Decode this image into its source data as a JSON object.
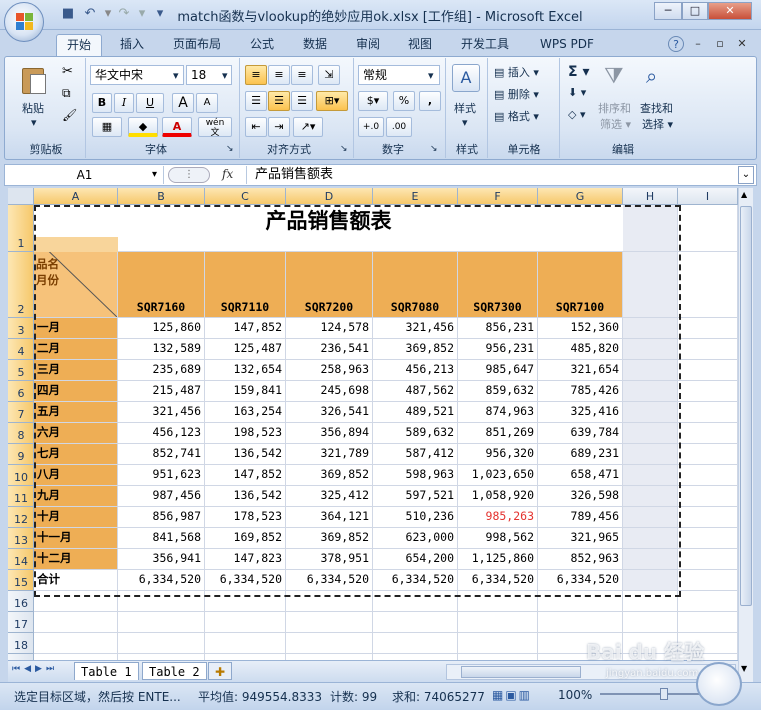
{
  "window": {
    "title": "match函数与vlookup的绝妙应用ok.xlsx  [工作组] - Microsoft Excel",
    "min": "─",
    "max": "□",
    "close": "✕"
  },
  "qat": {
    "save": "💾",
    "undo": "↶",
    "redo": "↷",
    "more": "▾"
  },
  "tabs": [
    "开始",
    "插入",
    "页面布局",
    "公式",
    "数据",
    "审阅",
    "视图",
    "开发工具",
    "WPS PDF"
  ],
  "tabs_active": 0,
  "ribbon": {
    "clipboard": {
      "label": "剪贴板",
      "paste": "粘贴"
    },
    "font": {
      "label": "字体",
      "name": "华文中宋",
      "size": "18",
      "bold": "B",
      "italic": "I",
      "underline": "U",
      "grow": "A",
      "shrink": "A",
      "color": "A",
      "wen": "wén"
    },
    "align": {
      "label": "对齐方式"
    },
    "number": {
      "label": "数字",
      "format": "常规",
      "percent": "%",
      "comma": ",",
      "inc": "+.0",
      "dec": ".00"
    },
    "style": {
      "label": "样式",
      "name": "样式"
    },
    "cells": {
      "label": "单元格",
      "insert": "插入",
      "delete": "删除",
      "format": "格式"
    },
    "edit": {
      "label": "编辑",
      "sort": "排序和",
      "sort2": "筛选",
      "find": "查找和",
      "find2": "选择",
      "sigma": "Σ"
    }
  },
  "formula": {
    "namebox": "A1",
    "fx": "fx",
    "content": "产品销售额表"
  },
  "sheet": {
    "columns": [
      "A",
      "B",
      "C",
      "D",
      "E",
      "F",
      "G",
      "H",
      "I"
    ],
    "title": "产品销售额表",
    "corner_top": "品名",
    "corner_bottom": "月份",
    "products": [
      "SQR7160",
      "SQR7110",
      "SQR7200",
      "SQR7080",
      "SQR7300",
      "SQR7100"
    ],
    "rows": [
      {
        "month": "一月",
        "values": [
          "125,860",
          "147,852",
          "124,578",
          "321,456",
          "856,231",
          "152,360"
        ]
      },
      {
        "month": "二月",
        "values": [
          "132,589",
          "125,487",
          "236,541",
          "369,852",
          "956,231",
          "485,820"
        ]
      },
      {
        "month": "三月",
        "values": [
          "235,689",
          "132,654",
          "258,963",
          "456,213",
          "985,647",
          "321,654"
        ]
      },
      {
        "month": "四月",
        "values": [
          "215,487",
          "159,841",
          "245,698",
          "487,562",
          "859,632",
          "785,426"
        ]
      },
      {
        "month": "五月",
        "values": [
          "321,456",
          "163,254",
          "326,541",
          "489,521",
          "874,963",
          "325,416"
        ]
      },
      {
        "month": "六月",
        "values": [
          "456,123",
          "198,523",
          "356,894",
          "589,632",
          "851,269",
          "639,784"
        ]
      },
      {
        "month": "七月",
        "values": [
          "852,741",
          "136,542",
          "321,789",
          "587,412",
          "956,320",
          "689,231"
        ]
      },
      {
        "month": "八月",
        "values": [
          "951,623",
          "147,852",
          "369,852",
          "598,963",
          "1,023,650",
          "658,471"
        ]
      },
      {
        "month": "九月",
        "values": [
          "987,456",
          "136,542",
          "325,412",
          "597,521",
          "1,058,920",
          "326,598"
        ]
      },
      {
        "month": "十月",
        "values": [
          "856,987",
          "178,523",
          "364,121",
          "510,236",
          "985,263",
          "789,456"
        ]
      },
      {
        "month": "十一月",
        "values": [
          "841,568",
          "169,852",
          "369,852",
          "623,000",
          "998,562",
          "321,965"
        ]
      },
      {
        "month": "十二月",
        "values": [
          "356,941",
          "147,823",
          "378,951",
          "654,200",
          "1,125,860",
          "852,963"
        ]
      }
    ],
    "total_label": "合计",
    "totals": [
      "6,334,520",
      "6,334,520",
      "6,334,520",
      "6,334,520",
      "6,334,520",
      "6,334,520"
    ],
    "highlight_color": "#e4322f",
    "row_numbers": [
      "1",
      "2",
      "3",
      "4",
      "5",
      "6",
      "7",
      "8",
      "9",
      "10",
      "11",
      "12",
      "13",
      "14",
      "15",
      "16",
      "17",
      "18",
      "19"
    ]
  },
  "sheet_tabs": [
    "Table 1",
    "Table 2"
  ],
  "status": {
    "mode": "选定目标区域，然后按 ENTE...",
    "average": "平均值: 949554.8333",
    "count": "计数: 99",
    "sum": "求和: 74065277",
    "zoom": "100%"
  },
  "watermark": "Bai du 经验",
  "watermark_sub": "jingyan.baidu.com"
}
